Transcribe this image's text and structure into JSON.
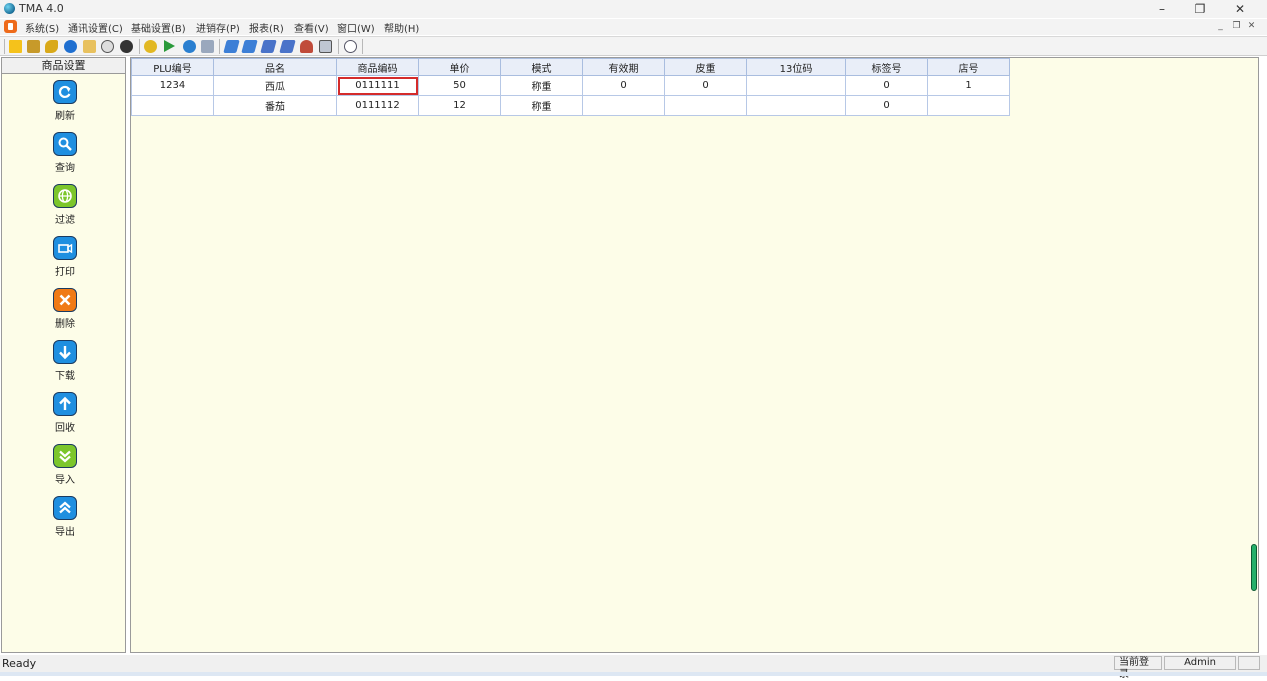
{
  "window": {
    "title": "TMA 4.0"
  },
  "menu": {
    "items": [
      "系统(S)",
      "通讯设置(C)",
      "基础设置(B)",
      "进销存(P)",
      "报表(R)",
      "查看(V)",
      "窗口(W)",
      "帮助(H)"
    ]
  },
  "sidebar": {
    "title": "商品设置",
    "buttons": [
      {
        "label": "刷新",
        "icon": "refresh-icon",
        "color": "#1f8fe0"
      },
      {
        "label": "查询",
        "icon": "search-icon",
        "color": "#1f8fe0"
      },
      {
        "label": "过滤",
        "icon": "filter-globe-icon",
        "color": "#7cc62b"
      },
      {
        "label": "打印",
        "icon": "print-icon",
        "color": "#1f8fe0"
      },
      {
        "label": "删除",
        "icon": "delete-icon",
        "color": "#f07a16"
      },
      {
        "label": "下载",
        "icon": "download-arrow-icon",
        "color": "#1f8fe0"
      },
      {
        "label": "回收",
        "icon": "upload-arrow-icon",
        "color": "#1f8fe0"
      },
      {
        "label": "导入",
        "icon": "import-chevrons-icon",
        "color": "#7cc62b"
      },
      {
        "label": "导出",
        "icon": "export-chevrons-icon",
        "color": "#1f8fe0"
      }
    ]
  },
  "grid": {
    "columns": [
      "PLU编号",
      "品名",
      "商品编码",
      "单价",
      "模式",
      "有效期",
      "皮重",
      "13位码",
      "标签号",
      "店号"
    ],
    "rows": [
      [
        "1234",
        "西瓜",
        "0111111",
        "50",
        "称重",
        "0",
        "0",
        "",
        "0",
        "1"
      ],
      [
        "",
        "番茄",
        "0111112",
        "12",
        "称重",
        "",
        "",
        "",
        "0",
        ""
      ]
    ]
  },
  "status": {
    "text": "Ready",
    "login_label": "当前登录",
    "user": "Admin"
  }
}
